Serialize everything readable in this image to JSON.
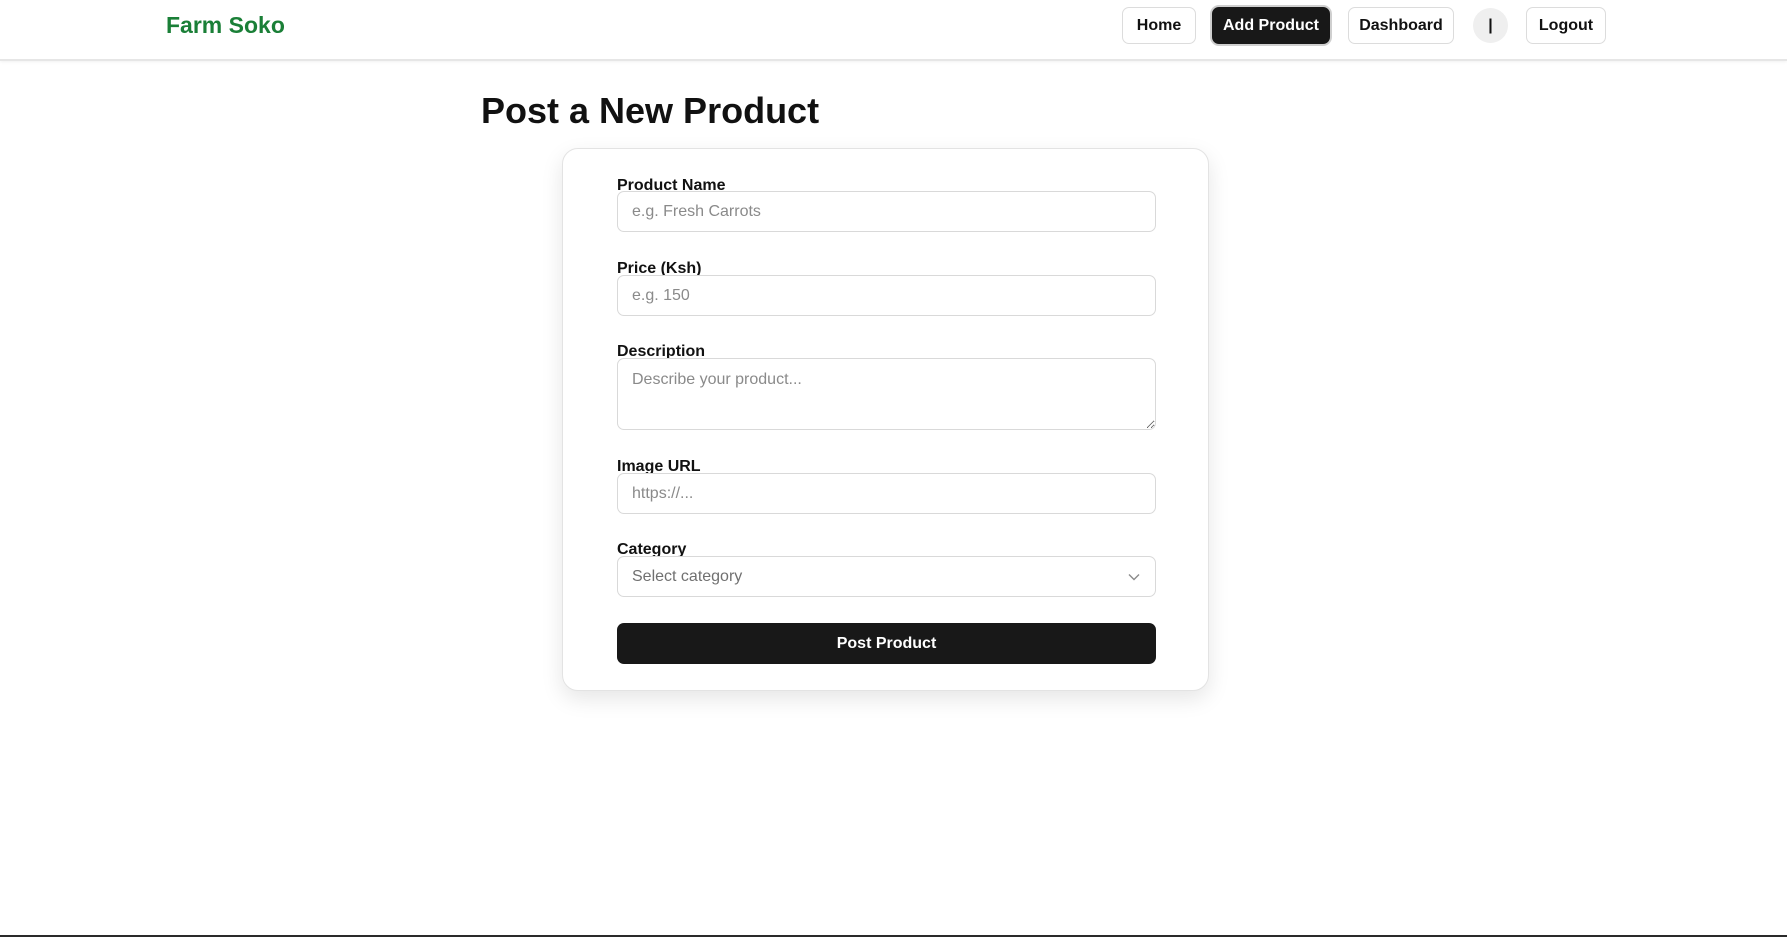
{
  "navbar": {
    "brand": "Farm Soko",
    "brand_color": "#1a7f37",
    "buttons": [
      {
        "label": "Home",
        "active": false
      },
      {
        "label": "Add Product",
        "active": true
      },
      {
        "label": "Dashboard",
        "active": false
      }
    ],
    "avatar_text": "|",
    "logout_label": "Logout"
  },
  "page": {
    "title": "Post a New Product"
  },
  "form": {
    "product_name": {
      "label": "Product Name",
      "placeholder": "e.g. Fresh Carrots",
      "value": ""
    },
    "price": {
      "label": "Price (Ksh)",
      "placeholder": "e.g. 150",
      "value": ""
    },
    "description": {
      "label": "Description",
      "placeholder": "Describe your product...",
      "value": ""
    },
    "image_url": {
      "label": "Image URL",
      "placeholder": "https://...",
      "value": ""
    },
    "category": {
      "label": "Category",
      "selected": "Select category",
      "icon": "chevron-down-icon"
    },
    "submit_label": "Post Product"
  },
  "colors": {
    "primary_dark": "#181818",
    "border": "#d9d9d9",
    "background": "#ffffff"
  }
}
